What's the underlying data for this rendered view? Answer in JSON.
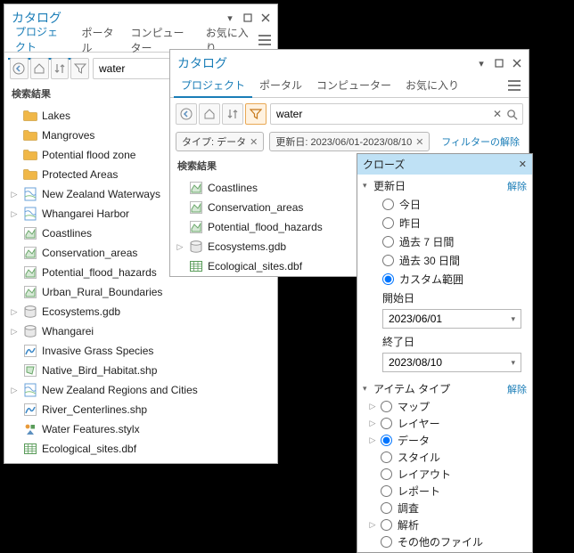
{
  "panel1": {
    "title": "カタログ",
    "tabs": [
      "プロジェクト",
      "ポータル",
      "コンピューター",
      "お気に入り"
    ],
    "activeTab": 0,
    "search": {
      "value": "water",
      "placeholder": ""
    },
    "sectionHeader": "検索結果",
    "items": [
      {
        "type": "folder",
        "label": "Lakes",
        "expand": "none"
      },
      {
        "type": "folder",
        "label": "Mangroves",
        "expand": "none"
      },
      {
        "type": "folder",
        "label": "Potential flood zone",
        "expand": "none"
      },
      {
        "type": "folder",
        "label": "Protected Areas",
        "expand": "none"
      },
      {
        "type": "map",
        "label": "New Zealand Waterways",
        "expand": "col"
      },
      {
        "type": "map",
        "label": "Whangarei Harbor",
        "expand": "col"
      },
      {
        "type": "fc",
        "label": "Coastlines",
        "expand": "none"
      },
      {
        "type": "fc",
        "label": "Conservation_areas",
        "expand": "none"
      },
      {
        "type": "fc",
        "label": "Potential_flood_hazards",
        "expand": "none"
      },
      {
        "type": "fc",
        "label": "Urban_Rural_Boundaries",
        "expand": "none"
      },
      {
        "type": "gdb",
        "label": "Ecosystems.gdb",
        "expand": "col"
      },
      {
        "type": "gdb",
        "label": "Whangarei",
        "expand": "col"
      },
      {
        "type": "line",
        "label": "Invasive Grass Species",
        "expand": "none"
      },
      {
        "type": "shp",
        "label": "Native_Bird_Habitat.shp",
        "expand": "none"
      },
      {
        "type": "map",
        "label": "New Zealand Regions and Cities",
        "expand": "col"
      },
      {
        "type": "line",
        "label": "River_Centerlines.shp",
        "expand": "none"
      },
      {
        "type": "stylx",
        "label": "Water Features.stylx",
        "expand": "none"
      },
      {
        "type": "table",
        "label": "Ecological_sites.dbf",
        "expand": "none"
      }
    ]
  },
  "panel2": {
    "title": "カタログ",
    "tabs": [
      "プロジェクト",
      "ポータル",
      "コンピューター",
      "お気に入り"
    ],
    "activeTab": 0,
    "search": {
      "value": "water",
      "placeholder": ""
    },
    "chips": [
      {
        "label": "タイプ: データ"
      },
      {
        "label": "更新日: 2023/06/01-2023/08/10"
      }
    ],
    "clearFilters": "フィルターの解除",
    "sectionHeader": "検索結果",
    "items": [
      {
        "type": "fc",
        "label": "Coastlines",
        "expand": "none"
      },
      {
        "type": "fc",
        "label": "Conservation_areas",
        "expand": "none"
      },
      {
        "type": "fc",
        "label": "Potential_flood_hazards",
        "expand": "none"
      },
      {
        "type": "gdb",
        "label": "Ecosystems.gdb",
        "expand": "col"
      },
      {
        "type": "table",
        "label": "Ecological_sites.dbf",
        "expand": "none"
      }
    ]
  },
  "popup": {
    "title": "クローズ",
    "group1": {
      "title": "更新日",
      "release": "解除",
      "radios": [
        "今日",
        "昨日",
        "過去 7 日間",
        "過去 30 日間",
        "カスタム範囲"
      ],
      "selected": 4,
      "startLabel": "開始日",
      "startValue": "2023/06/01",
      "endLabel": "終了日",
      "endValue": "2023/08/10"
    },
    "group2": {
      "title": "アイテム タイプ",
      "release": "解除",
      "items": [
        {
          "label": "マップ",
          "expand": true,
          "checked": false
        },
        {
          "label": "レイヤー",
          "expand": true,
          "checked": false
        },
        {
          "label": "データ",
          "expand": true,
          "checked": true
        },
        {
          "label": "スタイル",
          "expand": false,
          "checked": false
        },
        {
          "label": "レイアウト",
          "expand": false,
          "checked": false
        },
        {
          "label": "レポート",
          "expand": false,
          "checked": false
        },
        {
          "label": "調査",
          "expand": false,
          "checked": false
        },
        {
          "label": "解析",
          "expand": true,
          "checked": false
        },
        {
          "label": "その他のファイル",
          "expand": false,
          "checked": false
        }
      ]
    }
  }
}
